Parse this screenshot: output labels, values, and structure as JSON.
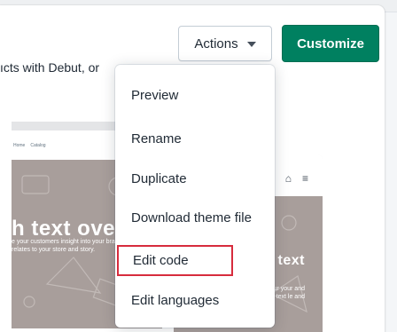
{
  "header": {
    "actions_label": "Actions",
    "customize_label": "Customize"
  },
  "description": "ıcts with Debut, or",
  "preview": {
    "desktop_nav": [
      "Home",
      "Catalog"
    ],
    "desktop_hero_title": "h text over",
    "desktop_hero_sub": "e your customers insight into your brand and text that relates to your store and story.",
    "mobile_hero_title": "text",
    "mobile_hero_sub": "your your and text le and"
  },
  "actions_menu": {
    "items": [
      {
        "label": "Preview"
      },
      {
        "label": "Rename"
      },
      {
        "label": "Duplicate"
      },
      {
        "label": "Download theme file"
      },
      {
        "label": "Edit code"
      },
      {
        "label": "Edit languages"
      }
    ],
    "highlighted_item": "Edit code",
    "highlight_color": "#d72c3d"
  },
  "colors": {
    "primary": "#008060",
    "hero_bg": "#a89e9b"
  }
}
